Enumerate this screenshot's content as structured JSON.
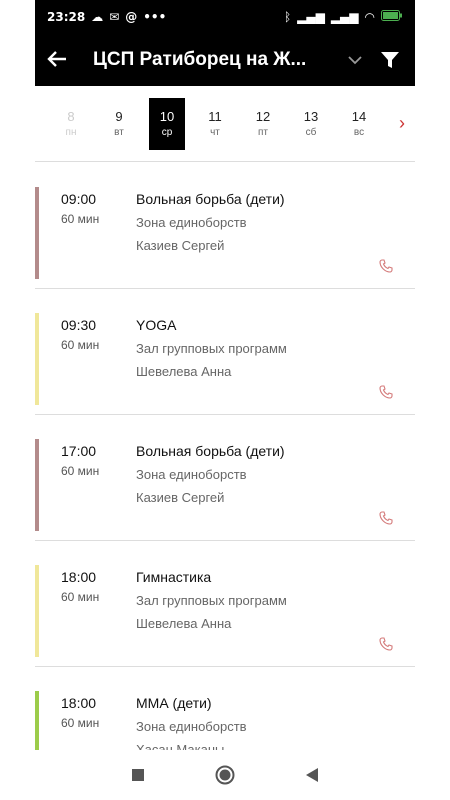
{
  "status": {
    "time": "23:28",
    "icons_left": [
      "cloud-icon",
      "mail-icon",
      "at-icon",
      "more-dots-icon"
    ],
    "icons_right": [
      "bluetooth-icon",
      "signal-icon",
      "signal-icon",
      "wifi-icon",
      "battery-icon"
    ]
  },
  "header": {
    "title": "ЦСП Ратиборец на Ж...",
    "back_icon": "back-arrow-icon",
    "dropdown_icon": "chevron-down-icon",
    "filter_icon": "filter-icon"
  },
  "days": [
    {
      "num": "8",
      "dow": "пн",
      "state": "disabled"
    },
    {
      "num": "9",
      "dow": "вт",
      "state": "normal"
    },
    {
      "num": "10",
      "dow": "ср",
      "state": "selected"
    },
    {
      "num": "11",
      "dow": "чт",
      "state": "normal"
    },
    {
      "num": "12",
      "dow": "пт",
      "state": "normal"
    },
    {
      "num": "13",
      "dow": "сб",
      "state": "normal"
    },
    {
      "num": "14",
      "dow": "вс",
      "state": "normal"
    }
  ],
  "accent_colors": {
    "wrestling": "#b38b8b",
    "group": "#f0e79a",
    "mma": "#9ccc4a",
    "phone": "#d47a7a"
  },
  "classes": [
    {
      "time": "09:00",
      "duration": "60 мин",
      "name": "Вольная борьба (дети)",
      "zone": "Зона единоборств",
      "trainer": "Казиев  Сергей",
      "color": "#b38b8b"
    },
    {
      "time": "09:30",
      "duration": "60 мин",
      "name": "YOGA",
      "zone": "Зал групповых программ",
      "trainer": "Шевелева Анна",
      "color": "#f0e79a"
    },
    {
      "time": "17:00",
      "duration": "60 мин",
      "name": "Вольная борьба (дети)",
      "zone": "Зона единоборств",
      "trainer": "Казиев  Сергей",
      "color": "#b38b8b"
    },
    {
      "time": "18:00",
      "duration": "60 мин",
      "name": "Гимнастика",
      "zone": "Зал групповых программ",
      "trainer": "Шевелева Анна",
      "color": "#f0e79a"
    },
    {
      "time": "18:00",
      "duration": "60 мин",
      "name": "ММА (дети)",
      "zone": "Зона единоборств",
      "trainer": "Хасан Маканы",
      "color": "#9ccc4a"
    }
  ],
  "navbar": [
    "recent-apps-square-icon",
    "home-circle-icon",
    "back-triangle-icon"
  ]
}
